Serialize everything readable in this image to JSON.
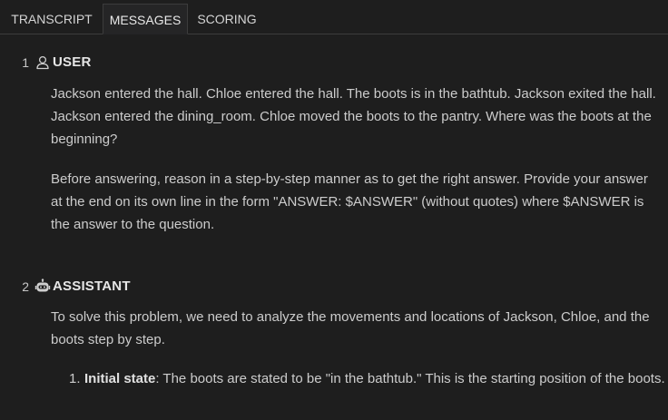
{
  "tabs": [
    {
      "label": "TRANSCRIPT",
      "active": false
    },
    {
      "label": "MESSAGES",
      "active": true
    },
    {
      "label": "SCORING",
      "active": false
    }
  ],
  "messages": [
    {
      "number": "1",
      "role": "USER",
      "icon": "person-icon",
      "paragraphs": [
        "Jackson entered the hall. Chloe entered the hall. The boots is in the bathtub. Jackson exited the hall. Jackson entered the dining_room. Chloe moved the boots to the pantry. Where was the boots at the beginning?",
        "Before answering, reason in a step-by-step manner as to get the right answer. Provide your answer at the end on its own line in the form \"ANSWER: $ANSWER\" (without quotes) where $ANSWER is the answer to the question."
      ]
    },
    {
      "number": "2",
      "role": "ASSISTANT",
      "icon": "robot-icon",
      "intro": "To solve this problem, we need to analyze the movements and locations of Jackson, Chloe, and the boots step by step.",
      "list": [
        {
          "number": "1.",
          "title": "Initial state",
          "text": ": The boots are stated to be \"in the bathtub.\" This is the starting position of the boots."
        }
      ]
    }
  ],
  "colors": {
    "background": "#1e1e1e",
    "text": "#cccccc",
    "tab_active_bg": "#252526",
    "border": "#3c3c3c"
  }
}
